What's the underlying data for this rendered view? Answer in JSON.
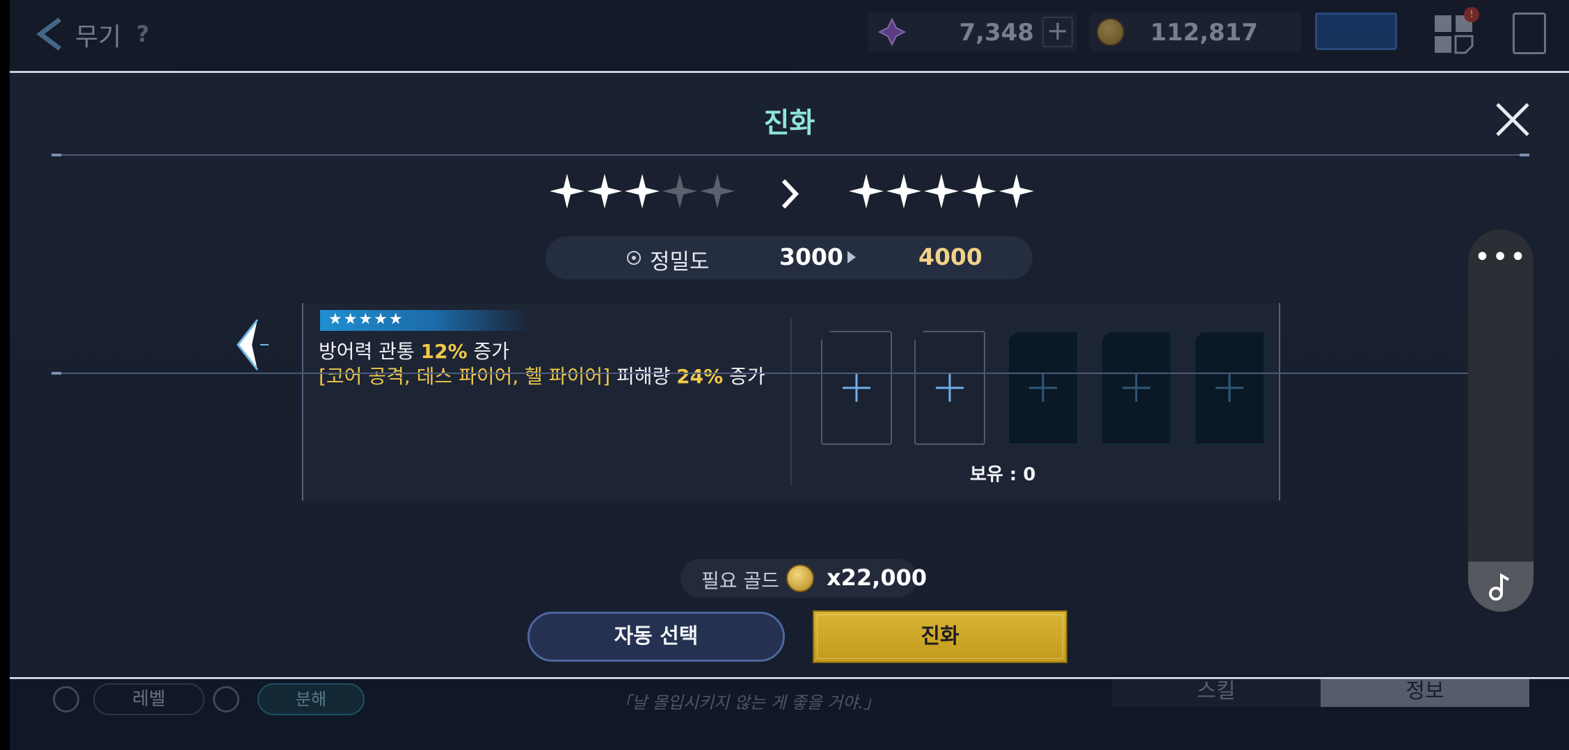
{
  "topbar": {
    "back_label": "무기",
    "help_label": "?",
    "gems": "7,348",
    "gold": "112,817",
    "notification_badge": "!"
  },
  "modal": {
    "title": "진화",
    "current_stars": 3,
    "max_stars": 5,
    "next_stars": 5,
    "accuracy": {
      "label": "정밀도",
      "from": "3000",
      "to": "4000"
    },
    "effect": {
      "line1_prefix": "방어력 관통 ",
      "line1_value": "12%",
      "line1_suffix": " 증가",
      "line2_tags": "[코어 공격, 데스 파이어, 헬 파이어]",
      "line2_mid": " 피해량 ",
      "line2_value": "24%",
      "line2_suffix": " 증가"
    },
    "material_slots": [
      {
        "state": "open"
      },
      {
        "state": "open"
      },
      {
        "state": "locked"
      },
      {
        "state": "locked"
      },
      {
        "state": "locked"
      }
    ],
    "owned_label": "보유 : 0",
    "gold_required_label": "필요 골드",
    "gold_required_value": "x22,000",
    "auto_select_label": "자동 선택",
    "evolve_label": "진화"
  },
  "bottombar": {
    "level_label": "레벨",
    "dismantle_label": "분해",
    "quote": "「날 몰입시키지 않는 게 좋을 거야.」",
    "tab_skill": "스킬",
    "tab_info": "정보"
  },
  "colors": {
    "title": "#8fe5d8",
    "highlight": "#f1c94a",
    "accent_gold": "#c39a1d",
    "panel": "#1d2434"
  }
}
